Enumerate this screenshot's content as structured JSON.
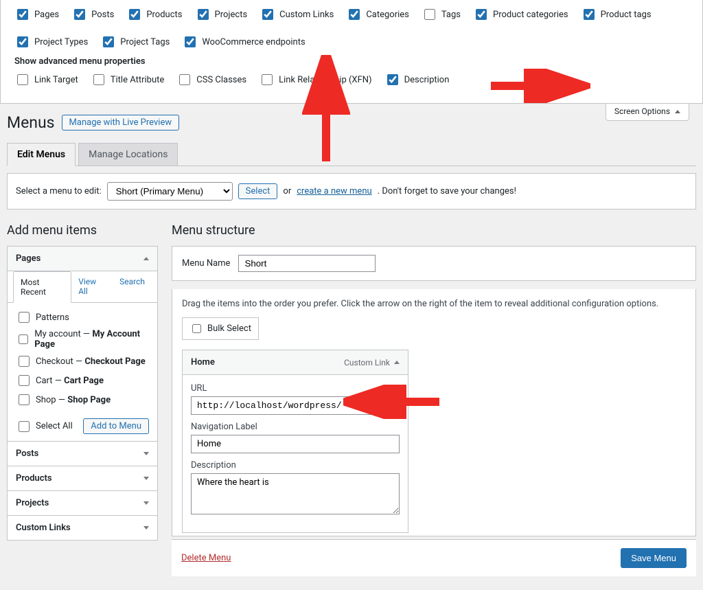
{
  "screenOptions": {
    "boxes": [
      {
        "label": "Pages",
        "checked": true
      },
      {
        "label": "Posts",
        "checked": true
      },
      {
        "label": "Products",
        "checked": true
      },
      {
        "label": "Projects",
        "checked": true
      },
      {
        "label": "Custom Links",
        "checked": true
      },
      {
        "label": "Categories",
        "checked": true
      },
      {
        "label": "Tags",
        "checked": false
      },
      {
        "label": "Product categories",
        "checked": true
      },
      {
        "label": "Product tags",
        "checked": true
      },
      {
        "label": "Project Types",
        "checked": true
      },
      {
        "label": "Project Tags",
        "checked": true
      },
      {
        "label": "WooCommerce endpoints",
        "checked": true
      }
    ],
    "advancedLabel": "Show advanced menu properties",
    "advanced": [
      {
        "label": "Link Target",
        "checked": false
      },
      {
        "label": "Title Attribute",
        "checked": false
      },
      {
        "label": "CSS Classes",
        "checked": false
      },
      {
        "label": "Link Relationship (XFN)",
        "checked": false
      },
      {
        "label": "Description",
        "checked": true
      }
    ],
    "tabLabel": "Screen Options"
  },
  "pageTitle": "Menus",
  "livePreview": "Manage with Live Preview",
  "tabs": {
    "edit": "Edit Menus",
    "locations": "Manage Locations"
  },
  "selectRow": {
    "label": "Select a menu to edit:",
    "selected": "Short (Primary Menu)",
    "selectBtn": "Select",
    "or": "or",
    "createLink": "create a new menu",
    "reminder": ". Don't forget to save your changes!"
  },
  "left": {
    "title": "Add menu items",
    "pages": {
      "header": "Pages",
      "tabs": {
        "recent": "Most Recent",
        "viewAll": "View All",
        "search": "Search"
      },
      "items": [
        {
          "label": "Patterns",
          "strong": ""
        },
        {
          "label": "My account — ",
          "strong": "My Account Page"
        },
        {
          "label": "Checkout — ",
          "strong": "Checkout Page"
        },
        {
          "label": "Cart — ",
          "strong": "Cart Page"
        },
        {
          "label": "Shop — ",
          "strong": "Shop Page"
        }
      ],
      "selectAll": "Select All",
      "addBtn": "Add to Menu"
    },
    "others": [
      "Posts",
      "Products",
      "Projects",
      "Custom Links"
    ]
  },
  "right": {
    "title": "Menu structure",
    "menuNameLabel": "Menu Name",
    "menuName": "Short",
    "instructions": "Drag the items into the order you prefer. Click the arrow on the right of the item to reveal additional configuration options.",
    "bulkSelect": "Bulk Select",
    "item": {
      "title": "Home",
      "type": "Custom Link",
      "urlLabel": "URL",
      "url": "http://localhost/wordpress/",
      "navLabelLabel": "Navigation Label",
      "navLabel": "Home",
      "descLabel": "Description",
      "desc": "Where the heart is"
    },
    "deleteMenu": "Delete Menu",
    "saveMenu": "Save Menu"
  }
}
